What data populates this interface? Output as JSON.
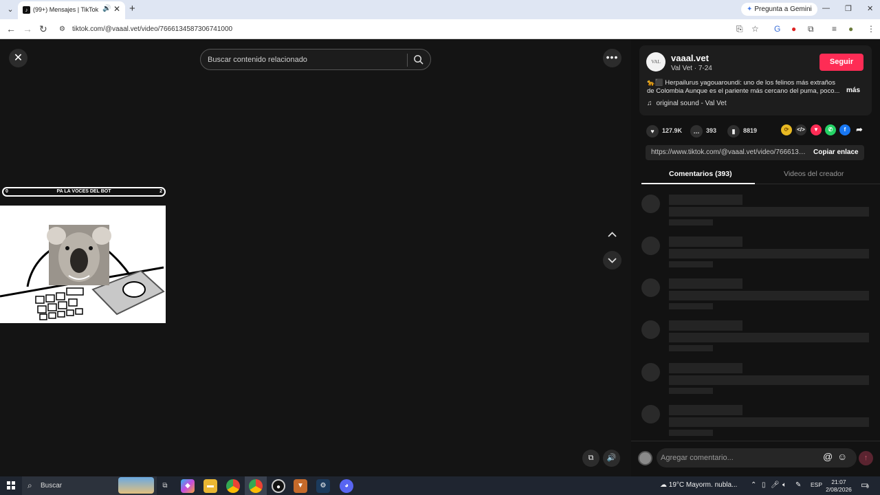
{
  "browser": {
    "tab_title": "(99+) Mensajes | TikTok",
    "url": "tiktok.com/@vaaal.vet/video/7666134587306741000",
    "gemini_label": "Pregunta a Gemini"
  },
  "search": {
    "placeholder": "Buscar contenido relacionado"
  },
  "video": {
    "overlay_left": "0",
    "overlay_center": "PA LA VOCES DEL BOT",
    "overlay_right": "2"
  },
  "author": {
    "avatar_text": "VAL",
    "username": "vaaal.vet",
    "subtitle": "Val Vet · 7-24",
    "follow_label": "Seguir"
  },
  "description": {
    "text": "🐆⬛ Herpailurus yagouaroundi: uno de los felinos más extraños de Colombia Aunque es el pariente más cercano del puma, poco...",
    "more_label": "más",
    "sound": "original sound - Val Vet"
  },
  "stats": {
    "likes": "127.9K",
    "comments": "393",
    "saves": "8819"
  },
  "share_link": {
    "url": "https://www.tiktok.com/@vaaal.vet/video/7666134...",
    "copy_label": "Copiar enlace"
  },
  "panel_tabs": {
    "comments": "Comentarios (393)",
    "creator_videos": "Videos del creador"
  },
  "comment_input": {
    "placeholder": "Agregar comentario..."
  },
  "taskbar": {
    "search_label": "Buscar",
    "weather": "19°C  Mayorm. nubla...",
    "language": "ESP",
    "time": "21:07",
    "date": "2/08/2026",
    "notifications": "9"
  },
  "colors": {
    "accent": "#fe2c55",
    "background": "#121212"
  }
}
